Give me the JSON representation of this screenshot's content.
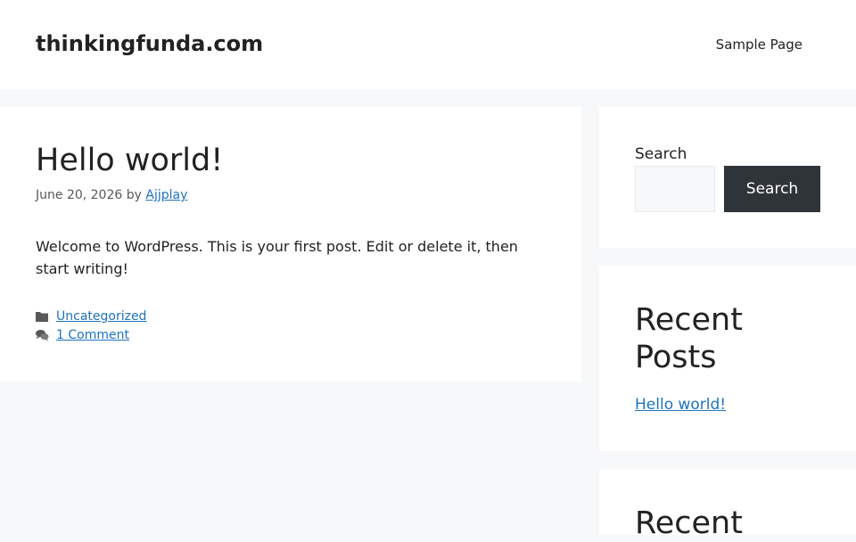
{
  "header": {
    "site_title": "thinkingfunda.com",
    "nav": [
      {
        "label": "Sample Page"
      }
    ]
  },
  "post": {
    "title": "Hello world!",
    "date": "June 20, 2026",
    "by": "by",
    "author": "Ajjplay",
    "body": "Welcome to WordPress. This is your first post. Edit or delete it, then start writing!",
    "category": "Uncategorized",
    "comments": "1 Comment",
    "icons": [
      "folder-icon",
      "comments-icon"
    ]
  },
  "sidebar": {
    "search": {
      "label": "Search",
      "value": "",
      "button_label": "Search"
    },
    "recent_posts": {
      "title": "Recent Posts",
      "items": [
        "Hello world!"
      ]
    },
    "recent_comments": {
      "title": "Recent"
    }
  },
  "colors": {
    "background": "#f7f8f9",
    "card": "#ffffff",
    "link": "#1e73be",
    "button": "#2f3439",
    "text": "#222222"
  }
}
